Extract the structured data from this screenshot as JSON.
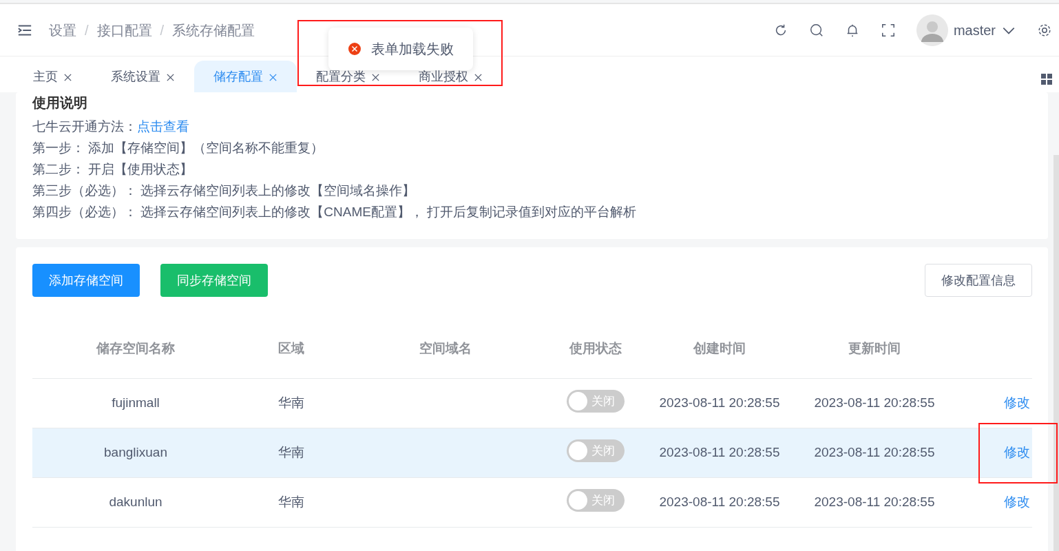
{
  "header": {
    "breadcrumb": [
      {
        "kind": "link",
        "text": "设置"
      },
      {
        "kind": "separator",
        "text": "/"
      },
      {
        "kind": "link",
        "text": "接口配置"
      },
      {
        "kind": "separator",
        "text": "/"
      },
      {
        "kind": "current",
        "text": "系统存储配置"
      }
    ],
    "user": "master"
  },
  "tabs": [
    {
      "label": "主页",
      "selected": false
    },
    {
      "label": "系统设置",
      "selected": false
    },
    {
      "label": "储存配置",
      "selected": true
    },
    {
      "label": "配置分类",
      "selected": false
    },
    {
      "label": "商业授权",
      "selected": false
    }
  ],
  "toast": {
    "kind": "error",
    "message": "表单加载失败"
  },
  "instructions": {
    "title": "使用说明",
    "lines": [
      {
        "text": "七牛云开通方法：",
        "link": "点击查看"
      },
      {
        "text": "第一步： 添加【存储空间】（空间名称不能重复）"
      },
      {
        "text": "第二步： 开启【使用状态】"
      },
      {
        "text": "第三步（必选）： 选择云存储空间列表上的修改【空间域名操作】"
      },
      {
        "text": "第四步（必选）： 选择云存储空间列表上的修改【CNAME配置】， 打开后复制记录值到对应的平台解析"
      }
    ]
  },
  "toolbar": {
    "buttons": [
      {
        "label": "添加存储空间",
        "kind": "primary"
      },
      {
        "label": "同步存储空间",
        "kind": "success"
      }
    ],
    "right_button": "修改配置信息"
  },
  "table": {
    "columns": [
      "储存空间名称",
      "区域",
      "空间域名",
      "使用状态",
      "创建时间",
      "更新时间"
    ],
    "rows": [
      {
        "name": "fujinmall",
        "region": "华南",
        "status": {
          "on": false,
          "label": "关闭"
        },
        "created": "2023-08-11 20:28:55",
        "updated": "2023-08-11 20:28:55",
        "action": "修改",
        "selected": false
      },
      {
        "name": "banglixuan",
        "region": "华南",
        "status": {
          "on": false,
          "label": "关闭"
        },
        "created": "2023-08-11 20:28:55",
        "updated": "2023-08-11 20:28:55",
        "action": "修改",
        "selected": true
      },
      {
        "name": "dakunlun",
        "region": "华南",
        "status": {
          "on": false,
          "label": "关闭"
        },
        "created": "2023-08-11 20:28:55",
        "updated": "2023-08-11 20:28:55",
        "action": "修改",
        "selected": false
      }
    ]
  }
}
